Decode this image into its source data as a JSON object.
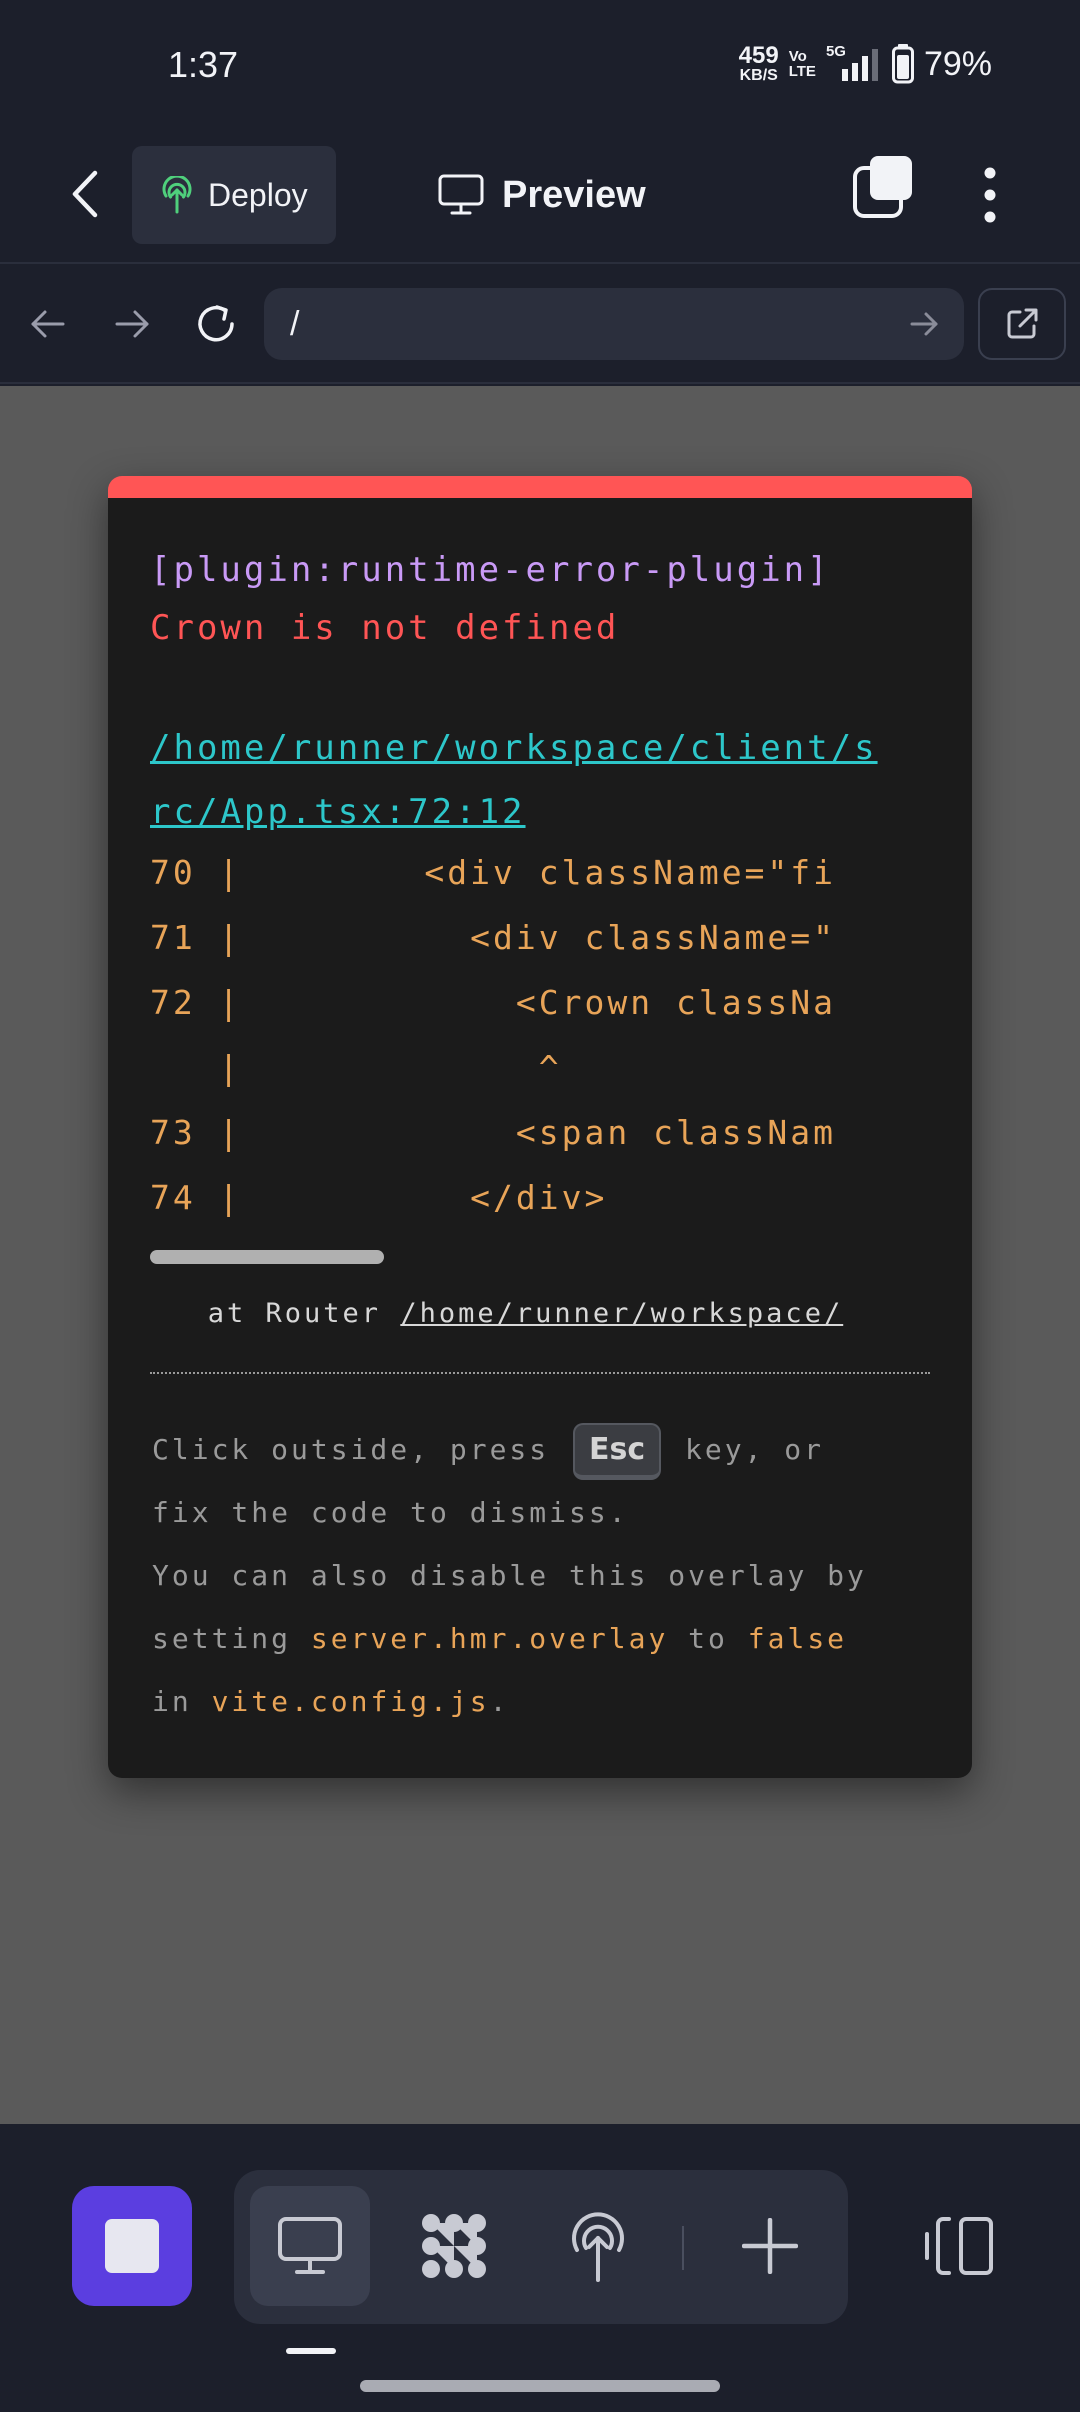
{
  "status_bar": {
    "time": "1:37",
    "net_speed_value": "459",
    "net_speed_unit": "KB/S",
    "volte_top": "Vo",
    "volte_bottom": "LTE",
    "network": "5G",
    "battery": "79%"
  },
  "top_bar": {
    "deploy_label": "Deploy",
    "title": "Preview"
  },
  "address_bar": {
    "url": "/"
  },
  "error_overlay": {
    "plugin": "[plugin:runtime-error-plugin]",
    "message": "Crown is not defined",
    "file_link": "/home/runner/workspace/client/src/App.tsx:72:12",
    "code_frame": [
      "70 |        <div className=\"fi",
      "71 |          <div className=\"",
      "72 |            <Crown classNa",
      "   |             ^",
      "73 |            <span classNam",
      "74 |          </div>"
    ],
    "stack_prefix": "   at Router ",
    "stack_link": "/home/runner/workspace/",
    "tip_click": "Click outside, press",
    "tip_key": "Esc",
    "tip_key_suffix": "key, or",
    "tip_fix": "fix the code to dismiss.",
    "tip_disable": "You can also disable this overlay by",
    "tip_setting": "setting",
    "tip_setting_code": "server.hmr.overlay",
    "tip_to": "to",
    "tip_false": "false",
    "tip_in": "in",
    "tip_config": "vite.config.js",
    "tip_period": "."
  }
}
